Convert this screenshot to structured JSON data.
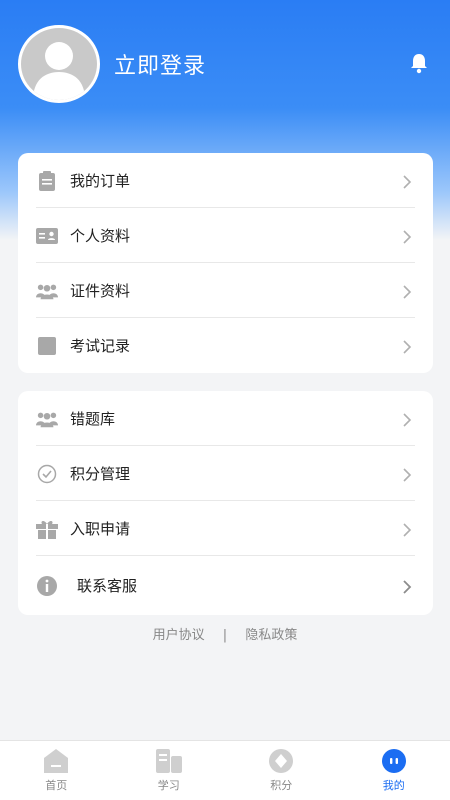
{
  "header": {
    "login_label": "立即登录",
    "avatar_icon": "user-avatar-icon",
    "bell_icon": "bell-icon"
  },
  "menu_group_1": [
    {
      "label": "我的订单",
      "icon": "clipboard-icon"
    },
    {
      "label": "个人资料",
      "icon": "id-card-icon"
    },
    {
      "label": "证件资料",
      "icon": "group-icon"
    },
    {
      "label": "考试记录",
      "icon": "square-icon"
    }
  ],
  "menu_group_2": [
    {
      "label": "错题库",
      "icon": "group-icon"
    },
    {
      "label": "积分管理",
      "icon": "check-circle-icon"
    },
    {
      "label": "入职申请",
      "icon": "gift-icon"
    },
    {
      "label": "联系客服",
      "icon": "info-icon"
    }
  ],
  "footer_links": {
    "user_agreement": "用户协议",
    "separator": "|",
    "privacy_policy": "隐私政策"
  },
  "tabbar": [
    {
      "label": "首页",
      "icon": "home-icon",
      "active": false
    },
    {
      "label": "学习",
      "icon": "study-icon",
      "active": false
    },
    {
      "label": "积分",
      "icon": "points-icon",
      "active": false
    },
    {
      "label": "我的",
      "icon": "profile-icon",
      "active": true
    }
  ],
  "colors": {
    "header_blue": "#2a7df4",
    "active_tab": "#1b6df2",
    "icon_gray": "#a8a8a8"
  }
}
